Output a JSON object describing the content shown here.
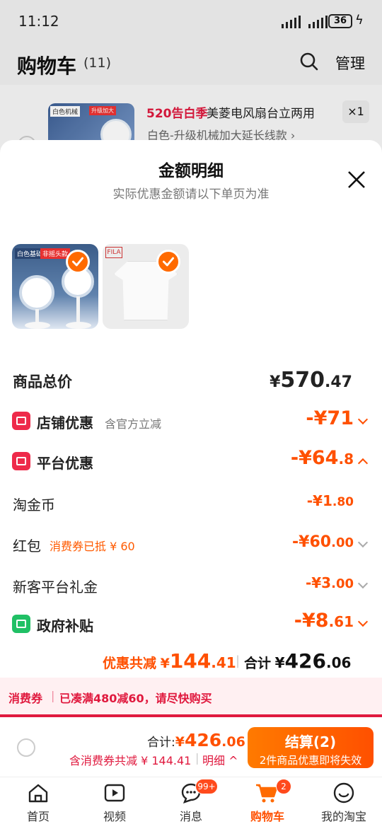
{
  "status": {
    "time": "11:12",
    "battery": "36"
  },
  "header": {
    "title": "购物车",
    "count": "(11)",
    "manage": "管理"
  },
  "cart_item": {
    "thumb_label": "白色机械",
    "thumb_label2": "升级加大",
    "tag": "520告白季",
    "name": "美菱电风扇台立两用",
    "qty": "×1",
    "sku": "白色-升级机械加大延长线款 ›"
  },
  "sheet": {
    "title": "金额明细",
    "subtitle": "实际优惠金额请以下单页为准",
    "thumbs": [
      {
        "label1": "白色基础",
        "label2": "非摇头款"
      },
      {
        "brand": "FILA"
      }
    ],
    "total": {
      "label": "商品总价",
      "yen": "¥",
      "int": "570",
      "dec": ".47"
    },
    "store_discount": {
      "label": "店铺优惠",
      "note": "含官方立减",
      "int": "-¥71",
      "dec": ""
    },
    "platform_discount": {
      "label": "平台优惠",
      "int": "-¥64",
      "dec": ".8"
    },
    "taojinbi": {
      "label": "淘金币",
      "int": "-¥1",
      "dec": ".80"
    },
    "hongbao": {
      "label": "红包",
      "note": "消费券已抵 ¥ 60",
      "int": "-¥60",
      "dec": ".00"
    },
    "newuser": {
      "label": "新客平台礼金",
      "int": "-¥3",
      "dec": ".00"
    },
    "gov": {
      "label": "政府补贴",
      "int": "-¥8",
      "dec": ".61"
    },
    "summary": {
      "saved_label": "优惠共减",
      "saved_yen": "¥",
      "saved_int": "144",
      "saved_dec": ".41",
      "sep": "|",
      "total_label": "合计",
      "total_yen": "¥",
      "total_int": "426",
      "total_dec": ".06"
    }
  },
  "coupon_bar": {
    "label": "消费券",
    "sep": "|",
    "text": "已凑满480减60，请尽快购买"
  },
  "checkout": {
    "total_label": "合计:",
    "total_yen": "¥",
    "total_int": "426",
    "total_dec": ".06",
    "saved_text": "含消费券共减 ¥ 144.41",
    "sep": "|",
    "detail": "明细 ^",
    "pay_label": "结算(2)",
    "pay_sub": "2件商品优惠即将失效"
  },
  "tabbar": {
    "items": [
      {
        "label": "首页"
      },
      {
        "label": "视频"
      },
      {
        "label": "消息",
        "badge": "99+"
      },
      {
        "label": "购物车",
        "badge": "2"
      },
      {
        "label": "我的淘宝"
      }
    ]
  },
  "colors": {
    "accent": "#ff5000",
    "red": "#e0193e",
    "green": "#20c065"
  }
}
